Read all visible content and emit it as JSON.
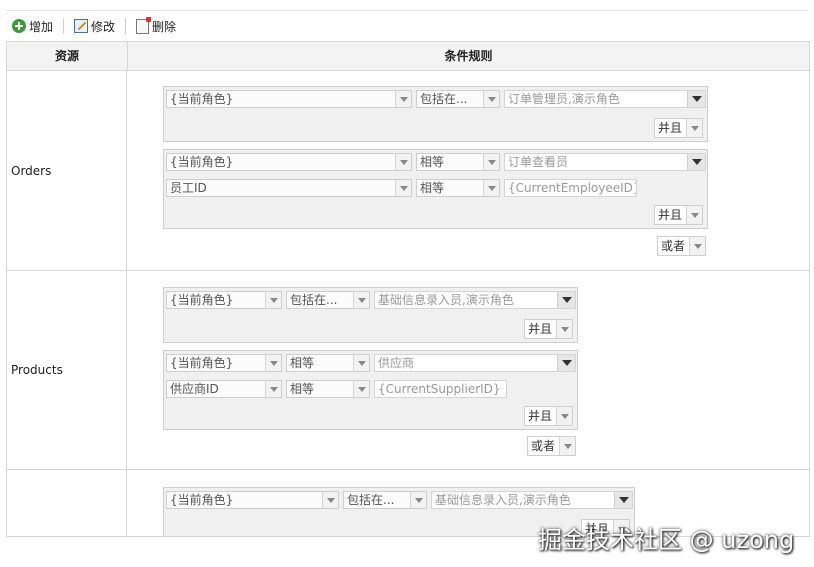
{
  "toolbar": {
    "add_label": "增加",
    "edit_label": "修改",
    "delete_label": "删除"
  },
  "table": {
    "col_resource": "资源",
    "col_rules": "条件规则"
  },
  "rows": [
    {
      "resource": "Orders",
      "groups": [
        {
          "conditions": [
            {
              "field": "{当前角色}",
              "op": "包括在...",
              "value": "订单管理员,演示角色"
            }
          ],
          "logic": "并且"
        },
        {
          "conditions": [
            {
              "field": "{当前角色}",
              "op": "相等",
              "value": "订单查看员"
            },
            {
              "field": "员工ID",
              "op": "相等",
              "value": "{CurrentEmployeeID}"
            }
          ],
          "logic": "并且"
        }
      ],
      "outer_logic": "或者"
    },
    {
      "resource": "Products",
      "groups": [
        {
          "conditions": [
            {
              "field": "{当前角色}",
              "op": "包括在...",
              "value": "基础信息录入员,演示角色"
            }
          ],
          "logic": "并且"
        },
        {
          "conditions": [
            {
              "field": "{当前角色}",
              "op": "相等",
              "value": "供应商"
            },
            {
              "field": "供应商ID",
              "op": "相等",
              "value": "{CurrentSupplierID}"
            }
          ],
          "logic": "并且"
        }
      ],
      "outer_logic": "或者"
    },
    {
      "resource": "",
      "groups": [
        {
          "conditions": [
            {
              "field": "{当前角色}",
              "op": "包括在...",
              "value": "基础信息录入员,演示角色"
            }
          ],
          "logic": "并且"
        }
      ]
    }
  ],
  "watermark": "掘金技术社区 @ uzong",
  "colors": {
    "add_icon": "#3a9b37",
    "group_bg": "#f0f0f0",
    "border": "#d6d6d6"
  },
  "icons": {
    "add": "plus-circle-icon",
    "edit": "edit-icon",
    "delete": "delete-icon"
  }
}
